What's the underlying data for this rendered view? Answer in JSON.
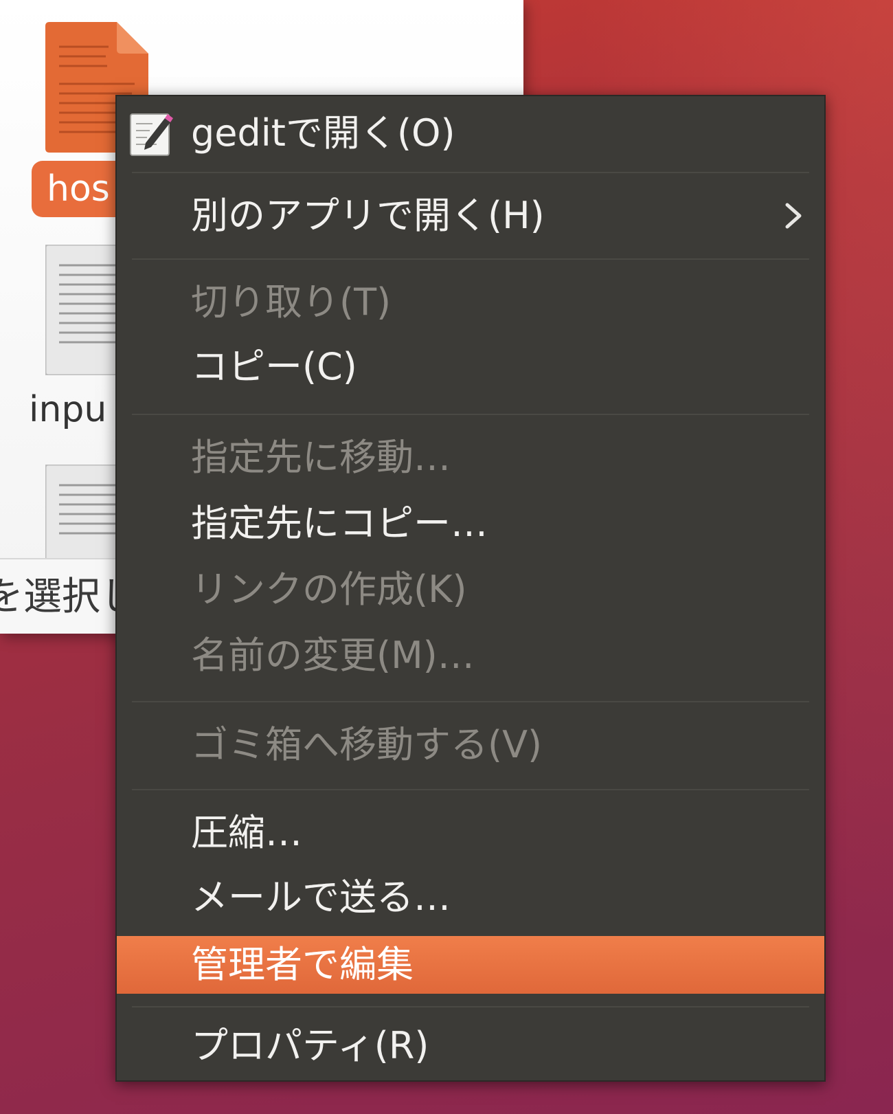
{
  "file_manager": {
    "selected_file_label": "hos",
    "second_file_label": "inpu",
    "status_text": "を選択し"
  },
  "context_menu": {
    "items": [
      {
        "label": "geditで開く(O)",
        "enabled": true,
        "icon": "gedit-text-editor-icon"
      },
      {
        "label": "別のアプリで開く(H)",
        "enabled": true,
        "submenu": true
      },
      {
        "label": "切り取り(T)",
        "enabled": false
      },
      {
        "label": "コピー(C)",
        "enabled": true
      },
      {
        "label": "指定先に移動…",
        "enabled": false
      },
      {
        "label": "指定先にコピー…",
        "enabled": true
      },
      {
        "label": "リンクの作成(K)",
        "enabled": false
      },
      {
        "label": "名前の変更(M)…",
        "enabled": false
      },
      {
        "label": "ゴミ箱へ移動する(V)",
        "enabled": false
      },
      {
        "label": "圧縮…",
        "enabled": true
      },
      {
        "label": "メールで送る…",
        "enabled": true
      },
      {
        "label": "管理者で編集",
        "enabled": true,
        "highlighted": true
      },
      {
        "label": "プロパティ(R)",
        "enabled": true
      }
    ]
  },
  "colors": {
    "menu_background": "#3c3b37",
    "highlight": "#e86d3c",
    "disabled_text": "#8d8a84",
    "file_icon_orange": "#e36a35"
  }
}
